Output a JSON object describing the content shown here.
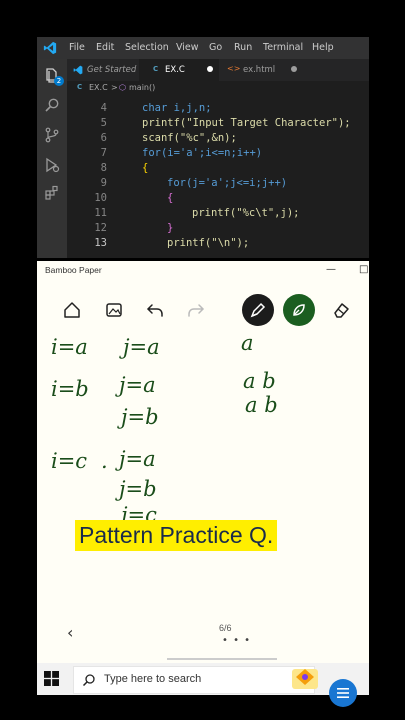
{
  "vscode": {
    "menu": [
      "File",
      "Edit",
      "Selection",
      "View",
      "Go",
      "Run",
      "Terminal",
      "Help"
    ],
    "explorer_badge": "2",
    "tabs": [
      {
        "label": "Get Started",
        "active": false
      },
      {
        "label": "EX.C",
        "active": true,
        "dirty": true
      },
      {
        "label": "ex.html",
        "active": false,
        "dirty": true
      }
    ],
    "breadcrumb": {
      "file": "EX.C",
      "separator": ">",
      "symbol": "main()"
    },
    "code": {
      "lines": [
        {
          "num": "4",
          "text": "char i,j,n;"
        },
        {
          "num": "5",
          "text": "printf(\"Input Target Character\");"
        },
        {
          "num": "6",
          "text": "scanf(\"%c\",&n);"
        },
        {
          "num": "7",
          "text": "for(i='a';i<=n;i++)"
        },
        {
          "num": "8",
          "text": "{"
        },
        {
          "num": "9",
          "text": "for(j='a';j<=i;j++)"
        },
        {
          "num": "10",
          "text": "{"
        },
        {
          "num": "11",
          "text": "printf(\"%c\\t\",j);"
        },
        {
          "num": "12",
          "text": "}"
        },
        {
          "num": "13",
          "text": "printf(\"\\n\");"
        }
      ]
    }
  },
  "bamboo": {
    "title": "Bamboo Paper",
    "window_controls": [
      "—",
      "□"
    ],
    "tools": [
      "home-icon",
      "image-icon",
      "undo-icon",
      "redo-icon",
      "pen-icon",
      "brush-icon",
      "eraser-icon"
    ],
    "handwriting": {
      "row1": [
        "i=a",
        "j=a",
        "a"
      ],
      "row2": [
        "i=b",
        "j=a",
        "j=b",
        "a b",
        "a b"
      ],
      "row3": [
        "i=c",
        ".",
        "j=a",
        "j=b",
        "j=c"
      ]
    },
    "caption": "Pattern Practice Q.",
    "page_indicator": "6/6",
    "more": "• • •"
  },
  "taskbar": {
    "search_placeholder": "Type here to search"
  },
  "colors": {
    "vscode_accent": "#007acc",
    "ink_green": "#1a4d1a",
    "caption_bg": "#ffee00",
    "fab_blue": "#1976d2"
  }
}
